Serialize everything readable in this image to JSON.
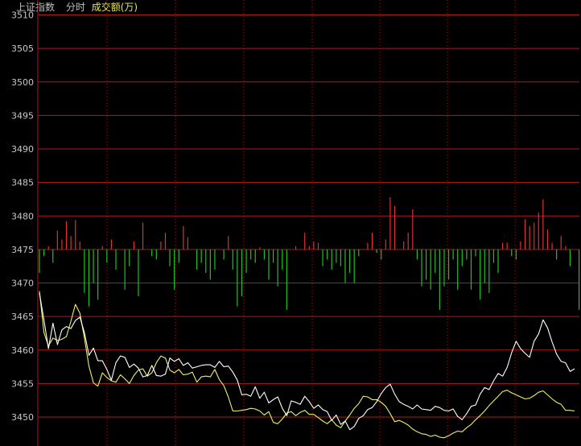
{
  "header": {
    "title": "上证指数",
    "mode": "分时",
    "metric": "成交额(万)"
  },
  "colors": {
    "grid": "#b01818",
    "axis_text": "#c8c8c8",
    "price_line": "#ffffff",
    "avg_line": "#f0f06a",
    "vol_up": "#e03030",
    "vol_down": "#22c022"
  },
  "chart_data": {
    "type": "line",
    "title": "",
    "xlabel": "",
    "ylabel": "",
    "ylim": [
      3446,
      3511
    ],
    "y_ticks": [
      3510,
      3505,
      3500,
      3495,
      3490,
      3485,
      3480,
      3475,
      3470,
      3465,
      3460,
      3455,
      3450
    ],
    "baseline": 3475,
    "grid": true,
    "x_count": 120,
    "series": [
      {
        "key": "price",
        "values": [
          3468.5,
          3464.5,
          3460.2,
          3464.0,
          3460.8,
          3463.0,
          3463.5,
          3463.2,
          3464.4,
          3464.9,
          3462.6,
          3459.2,
          3460.3,
          3458.4,
          3458.4,
          3457.1,
          3455.5,
          3458.1,
          3459.1,
          3458.9,
          3457.4,
          3457.9,
          3457.3,
          3456.0,
          3456.2,
          3457.7,
          3456.2,
          3456.1,
          3456.4,
          3458.8,
          3458.3,
          3458.7,
          3457.7,
          3458.1,
          3457.3,
          3457.5,
          3457.7,
          3457.8,
          3457.8,
          3457.4,
          3458.3,
          3457.5,
          3457.6,
          3456.7,
          3455.5,
          3453.3,
          3453.4,
          3453.1,
          3454.5,
          3452.8,
          3453.7,
          3452.1,
          3452.6,
          3453.0,
          3451.3,
          3450.2,
          3452.4,
          3452.2,
          3451.9,
          3453.1,
          3452.3,
          3451.3,
          3451.8,
          3451.1,
          3450.8,
          3449.5,
          3450.3,
          3448.9,
          3449.4,
          3448.1,
          3448.6,
          3449.8,
          3450.2,
          3451.1,
          3451.4,
          3452.3,
          3453.5,
          3454.4,
          3454.9,
          3453.4,
          3452.3,
          3451.9,
          3451.6,
          3451.2,
          3451.8,
          3451.2,
          3451.1,
          3451.0,
          3451.6,
          3451.4,
          3451.0,
          3450.9,
          3451.2,
          3450.1,
          3449.6,
          3450.5,
          3451.6,
          3451.8,
          3453.4,
          3454.4,
          3454.1,
          3455.4,
          3456.5,
          3456.1,
          3457.4,
          3459.6,
          3461.3,
          3460.2,
          3459.5,
          3458.9,
          3461.3,
          3462.4,
          3464.5,
          3463.3,
          3461.2,
          3459.4,
          3458.3,
          3458.1,
          3456.8,
          3457.2
        ]
      },
      {
        "key": "average",
        "values": [
          3468.8,
          3462.6,
          3460.6,
          3461.8,
          3461.4,
          3461.6,
          3462.0,
          3464.3,
          3466.8,
          3465.5,
          3461.8,
          3457.6,
          3455.1,
          3454.6,
          3456.6,
          3455.9,
          3455.4,
          3455.2,
          3456.3,
          3455.7,
          3455.0,
          3456.2,
          3457.0,
          3457.2,
          3456.1,
          3456.6,
          3458.1,
          3459.1,
          3458.8,
          3457.0,
          3456.6,
          3457.1,
          3456.3,
          3456.4,
          3456.7,
          3455.2,
          3456.0,
          3456.1,
          3456.0,
          3457.1,
          3455.6,
          3454.7,
          3453.0,
          3450.9,
          3450.9,
          3451.0,
          3451.1,
          3451.3,
          3451.2,
          3450.9,
          3450.3,
          3450.8,
          3449.2,
          3449.0,
          3449.7,
          3450.6,
          3450.8,
          3450.2,
          3450.7,
          3451.0,
          3450.4,
          3450.4,
          3449.9,
          3449.4,
          3449.0,
          3449.6,
          3448.8,
          3448.4,
          3449.4,
          3450.3,
          3451.3,
          3452.0,
          3453.1,
          3453.0,
          3452.6,
          3452.6,
          3452.2,
          3451.6,
          3450.5,
          3449.3,
          3449.5,
          3449.2,
          3448.8,
          3448.2,
          3447.8,
          3447.5,
          3447.4,
          3447.1,
          3447.3,
          3447.0,
          3446.9,
          3447.2,
          3447.6,
          3447.9,
          3447.8,
          3448.4,
          3448.9,
          3449.6,
          3450.2,
          3450.9,
          3451.7,
          3452.4,
          3453.1,
          3453.8,
          3454.0,
          3453.6,
          3453.3,
          3453.0,
          3452.7,
          3452.8,
          3453.2,
          3453.7,
          3453.9,
          3453.3,
          3452.7,
          3452.2,
          3451.9,
          3451.0,
          3451.0,
          3450.9
        ]
      },
      {
        "key": "volume_deviation",
        "values": [
          -3.5,
          -1.0,
          0.5,
          -2.0,
          2.8,
          1.5,
          4.2,
          2.0,
          4.4,
          1.2,
          -6.5,
          -8.5,
          -5.0,
          -7.5,
          0.5,
          -2.0,
          1.5,
          -3.0,
          0.0,
          -6.0,
          -2.5,
          1.2,
          -7.0,
          4.0,
          0.0,
          -1.0,
          -1.5,
          1.2,
          2.5,
          -2.5,
          -6.0,
          -2.0,
          3.5,
          1.8,
          0.0,
          -3.0,
          -2.0,
          -3.5,
          -4.5,
          -3.0,
          0.0,
          -1.5,
          2.0,
          -3.0,
          -8.5,
          -7.0,
          -3.5,
          -1.5,
          -2.0,
          0.3,
          -1.5,
          -4.5,
          -2.0,
          -5.5,
          -3.0,
          -9.0,
          0.0,
          0.5,
          0.0,
          2.5,
          0.5,
          1.2,
          1.0,
          -2.5,
          -1.5,
          -3.0,
          -2.0,
          -2.5,
          -5.0,
          -3.5,
          -5.0,
          -1.0,
          0.0,
          1.0,
          2.5,
          -0.5,
          -1.5,
          1.5,
          7.8,
          6.5,
          0.0,
          1.2,
          2.5,
          6.0,
          -1.5,
          -5.5,
          -4.5,
          -6.0,
          -3.5,
          -9.0,
          -5.5,
          -4.5,
          -1.5,
          -6.0,
          -2.5,
          -1.5,
          -6.0,
          -1.0,
          -7.5,
          -5.0,
          -6.5,
          -2.0,
          -3.5,
          1.0,
          1.0,
          -1.0,
          -1.5,
          1.2,
          4.5,
          3.5,
          4.0,
          5.5,
          7.5,
          3.0,
          1.0,
          -1.5,
          2.0,
          0.5,
          -2.5,
          0.0,
          -9.0
        ]
      }
    ]
  }
}
